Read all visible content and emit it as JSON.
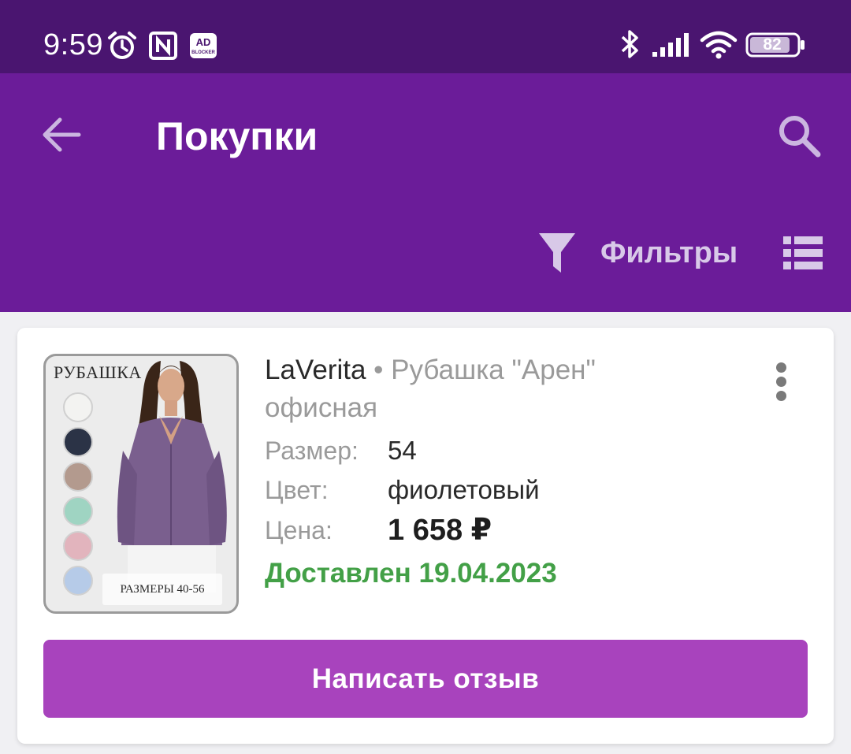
{
  "status_bar": {
    "time": "9:59",
    "battery_level": "82",
    "icons": [
      "alarm-icon",
      "nfc-icon",
      "ad-blocker-icon",
      "bluetooth-icon",
      "cell-signal-icon",
      "wifi-icon",
      "battery-icon"
    ]
  },
  "app_bar": {
    "title": "Покупки",
    "filter_label": "Фильтры",
    "icons": [
      "back-arrow-icon",
      "search-icon",
      "filter-funnel-icon",
      "list-view-icon"
    ]
  },
  "order": {
    "image": {
      "heading": "РУБАШКА",
      "sizes_caption": "РАЗМЕРЫ 40-56"
    },
    "brand": "LaVerita",
    "separator": "•",
    "product_name": "Рубашка \"Арен\" офисная",
    "size_label": "Размер:",
    "size_value": "54",
    "color_label": "Цвет:",
    "color_value": "фиолетовый",
    "price_label": "Цена:",
    "price_value": "1 658 ₽",
    "status": "Доставлен 19.04.2023",
    "review_button": "Написать отзыв"
  },
  "colors": {
    "status_bar": "#4a1570",
    "app_bar": "#6b1c99",
    "accent_button": "#a843bd",
    "delivered_status": "#43a047"
  }
}
